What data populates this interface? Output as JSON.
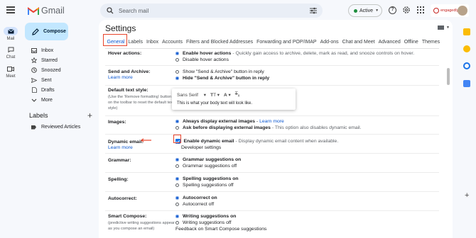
{
  "app": {
    "name": "Gmail"
  },
  "search": {
    "placeholder": "Search mail"
  },
  "status": {
    "label": "Active"
  },
  "brand": {
    "name": "engagedly"
  },
  "rail": [
    {
      "label": "Mail",
      "icon": "mail-icon"
    },
    {
      "label": "Chat",
      "icon": "chat-icon"
    },
    {
      "label": "Meet",
      "icon": "meet-icon"
    }
  ],
  "compose": {
    "label": "Compose"
  },
  "nav": [
    {
      "label": "Inbox",
      "icon": "inbox-icon"
    },
    {
      "label": "Starred",
      "icon": "star-icon"
    },
    {
      "label": "Snoozed",
      "icon": "clock-icon"
    },
    {
      "label": "Sent",
      "icon": "send-icon"
    },
    {
      "label": "Drafts",
      "icon": "draft-icon"
    },
    {
      "label": "More",
      "icon": "chevron-down-icon"
    }
  ],
  "labels": {
    "heading": "Labels",
    "items": [
      "Reviewed Articles"
    ]
  },
  "settings": {
    "title": "Settings",
    "tabs": [
      "General",
      "Labels",
      "Inbox",
      "Accounts",
      "Filters and Blocked Addresses",
      "Forwarding and POP/IMAP",
      "Add-ons",
      "Chat and Meet",
      "Advanced",
      "Offline",
      "Themes"
    ],
    "active_tab": "General",
    "hover": {
      "label": "Hover actions:",
      "opt1": "Enable hover actions",
      "opt1_desc": "- Quickly gain access to archive, delete, mark as read, and snooze controls on hover.",
      "opt2": "Disable hover actions"
    },
    "send_archive": {
      "label": "Send and Archive:",
      "learn": "Learn more",
      "opt1": "Show \"Send & Archive\" button in reply",
      "opt2": "Hide \"Send & Archive\" button in reply"
    },
    "text_style": {
      "label": "Default text style:",
      "sub": "(Use the 'Remove formatting' button on the toolbar to reset the default text style)",
      "font": "Sans Serif",
      "preview": "This is what your body text will look like."
    },
    "images": {
      "label": "Images:",
      "opt1": "Always display external images",
      "opt1_sep": "-",
      "opt1_link": "Learn more",
      "opt2": "Ask before displaying external images",
      "opt2_desc": "- This option also disables dynamic email."
    },
    "dynamic": {
      "label": "Dynamic email:",
      "learn": "Learn more",
      "opt": "Enable dynamic email",
      "opt_desc": "- Display dynamic email content when available.",
      "dev_link": "Developer settings"
    },
    "grammar": {
      "label": "Grammar:",
      "opt1": "Grammar suggestions on",
      "opt2": "Grammar suggestions off"
    },
    "spelling": {
      "label": "Spelling:",
      "opt1": "Spelling suggestions on",
      "opt2": "Spelling suggestions off"
    },
    "autocorrect": {
      "label": "Autocorrect:",
      "opt1": "Autocorrect on",
      "opt2": "Autocorrect off"
    },
    "smart_compose": {
      "label": "Smart Compose:",
      "sub": "(predictive writing suggestions appear as you compose an email)",
      "opt1": "Writing suggestions on",
      "opt2": "Writing suggestions off",
      "feedback": "Feedback on Smart Compose suggestions"
    }
  },
  "colors": {
    "accent": "#0b57d0",
    "highlight": "#e8442b",
    "compose_bg": "#c2e7ff",
    "page_bg": "#f6f8fc"
  }
}
